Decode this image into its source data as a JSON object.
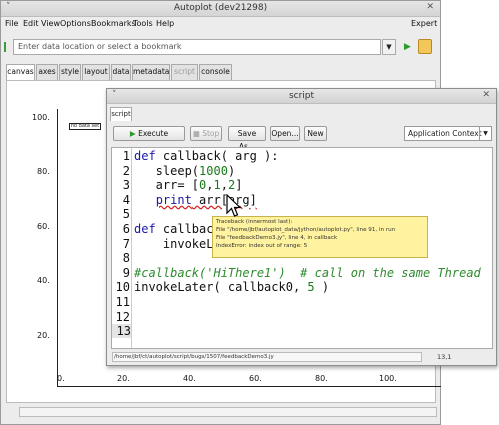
{
  "main_window": {
    "title": "Autoplot (dev21298)",
    "controls": {
      "left": "˅",
      "close": "✕"
    },
    "menu": [
      "File",
      "Edit",
      "View",
      "Options",
      "Bookmarks",
      "Tools",
      "Help"
    ],
    "expert_label": "Expert",
    "url_placeholder": "Enter data location or select a bookmark",
    "tabs": [
      "canvas",
      "axes",
      "style",
      "layout",
      "data",
      "metadata",
      "script",
      "console"
    ],
    "active_tab": "canvas",
    "disabled_tab": "script"
  },
  "plot": {
    "y_ticks": [
      "100.",
      "80.",
      "60.",
      "40.",
      "20.",
      "0."
    ],
    "x_ticks": [
      "0.",
      "20.",
      "40.",
      "60.",
      "80.",
      "100."
    ],
    "legend_label": "no data set"
  },
  "script_window": {
    "title": "script",
    "controls": {
      "left": "˅",
      "close": "✕"
    },
    "tab_label": "script",
    "buttons": {
      "execute": "Execute",
      "stop": "Stop",
      "save_as": "Save As...",
      "open": "Open...",
      "new": "New"
    },
    "context_select": "Application Context",
    "code_lines": [
      {
        "n": "1",
        "parts": [
          [
            "kw",
            "def"
          ],
          [
            "",
            " callback( arg ):"
          ]
        ]
      },
      {
        "n": "2",
        "parts": [
          [
            "",
            "   sleep("
          ],
          [
            "num",
            "1000"
          ],
          [
            "",
            ")"
          ]
        ]
      },
      {
        "n": "3",
        "parts": [
          [
            "",
            "   arr= ["
          ],
          [
            "num",
            "0"
          ],
          [
            "",
            ","
          ],
          [
            "num",
            "1"
          ],
          [
            "",
            ","
          ],
          [
            "num",
            "2"
          ],
          [
            "",
            "]"
          ]
        ]
      },
      {
        "n": "4",
        "parts": [
          [
            "",
            "   "
          ],
          [
            "kw err",
            "print"
          ],
          [
            "err",
            " arr[arg]"
          ]
        ]
      },
      {
        "n": "5",
        "parts": []
      },
      {
        "n": "6",
        "parts": [
          [
            "kw",
            "def"
          ],
          [
            "",
            " callbac"
          ]
        ]
      },
      {
        "n": "7",
        "parts": [
          [
            "",
            "    invokeL"
          ]
        ]
      },
      {
        "n": "8",
        "parts": []
      },
      {
        "n": "9",
        "parts": [
          [
            "cmt",
            "#callback('HiThere1')  # call on the same Thread"
          ]
        ]
      },
      {
        "n": "10",
        "parts": [
          [
            "",
            "invokeLater( callback0, "
          ],
          [
            "num",
            "5"
          ],
          [
            "",
            " )"
          ]
        ]
      },
      {
        "n": "11",
        "parts": []
      },
      {
        "n": "12",
        "parts": []
      },
      {
        "n": "13",
        "parts": []
      }
    ],
    "current_line": "13",
    "tooltip_lines": [
      "Traceback (innermost last):",
      "File \"/home/jbf/autoplot_data/jython/autoplot.py\", line 91, in run",
      "File \"feedbackDemo3.jy\", line 4, in callback",
      "IndexError: index out of range: 5"
    ],
    "status_path": "/home/jbf/ct/autoplot/script/bugs/1507/feedbackDemo3.jy",
    "caret_pos": "13,1"
  },
  "colors": {
    "keyword": "#1a1aa6",
    "number": "#1a7a1a",
    "comment": "#2e8b2e",
    "error_underline": "#d02020",
    "tooltip_bg": "#fff3a0"
  }
}
